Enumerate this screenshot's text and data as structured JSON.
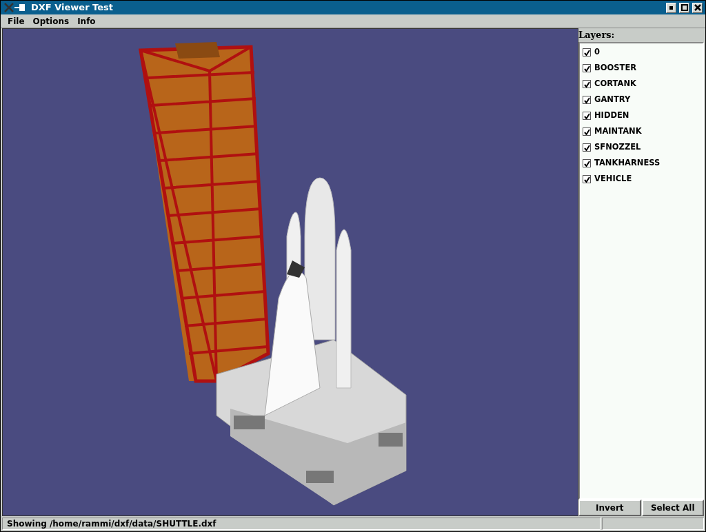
{
  "window": {
    "title": "DXF Viewer Test"
  },
  "menu": [
    "File",
    "Options",
    "Info"
  ],
  "layers_panel": {
    "title": "Layers:",
    "layers": [
      {
        "label": "0",
        "checked": true
      },
      {
        "label": "BOOSTER",
        "checked": true
      },
      {
        "label": "CORTANK",
        "checked": true
      },
      {
        "label": "GANTRY",
        "checked": true
      },
      {
        "label": "HIDDEN",
        "checked": true
      },
      {
        "label": "MAINTANK",
        "checked": true
      },
      {
        "label": "SFNOZZEL",
        "checked": true
      },
      {
        "label": "TANKHARNESS",
        "checked": true
      },
      {
        "label": "VEHICLE",
        "checked": true
      }
    ],
    "buttons": [
      "Invert",
      "Select All"
    ]
  },
  "status_bar": {
    "message": "Showing /home/rammi/dxf/data/SHUTTLE.dxf"
  }
}
